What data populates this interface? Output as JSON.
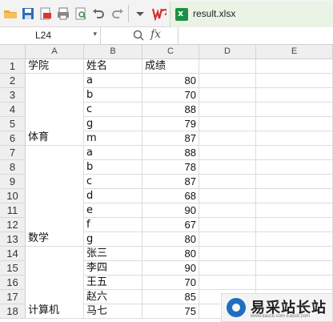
{
  "toolbar": {
    "icons": [
      "open-folder-icon",
      "save-icon",
      "export-pdf-icon",
      "print-icon",
      "print-preview-icon",
      "undo-icon",
      "redo-icon",
      "more-dropdown-icon",
      "wps-logo-icon"
    ],
    "file_tab_name": "result.xlsx"
  },
  "formula_bar": {
    "cell_ref": "L24",
    "fx_label": "fx",
    "formula": ""
  },
  "columns": [
    "A",
    "B",
    "C",
    "D",
    "E"
  ],
  "rows": [
    "1",
    "2",
    "3",
    "4",
    "5",
    "6",
    "7",
    "8",
    "9",
    "10",
    "11",
    "12",
    "13",
    "14",
    "15",
    "16",
    "17",
    "18"
  ],
  "header": {
    "a": "学院",
    "b": "姓名",
    "c": "成绩"
  },
  "groups": [
    {
      "name": "体育"
    },
    {
      "name": "数学"
    },
    {
      "name": "计算机"
    }
  ],
  "names": [
    "a",
    "b",
    "c",
    "g",
    "m",
    "a",
    "b",
    "c",
    "d",
    "e",
    "f",
    "g",
    "张三",
    "李四",
    "王五",
    "赵六",
    "马七"
  ],
  "scores": [
    "80",
    "70",
    "88",
    "79",
    "87",
    "88",
    "78",
    "87",
    "68",
    "90",
    "67",
    "80",
    "80",
    "90",
    "70",
    "85",
    "75"
  ],
  "watermark": {
    "title": "易采站长站",
    "url": "www.easck.com  Easck.com"
  }
}
